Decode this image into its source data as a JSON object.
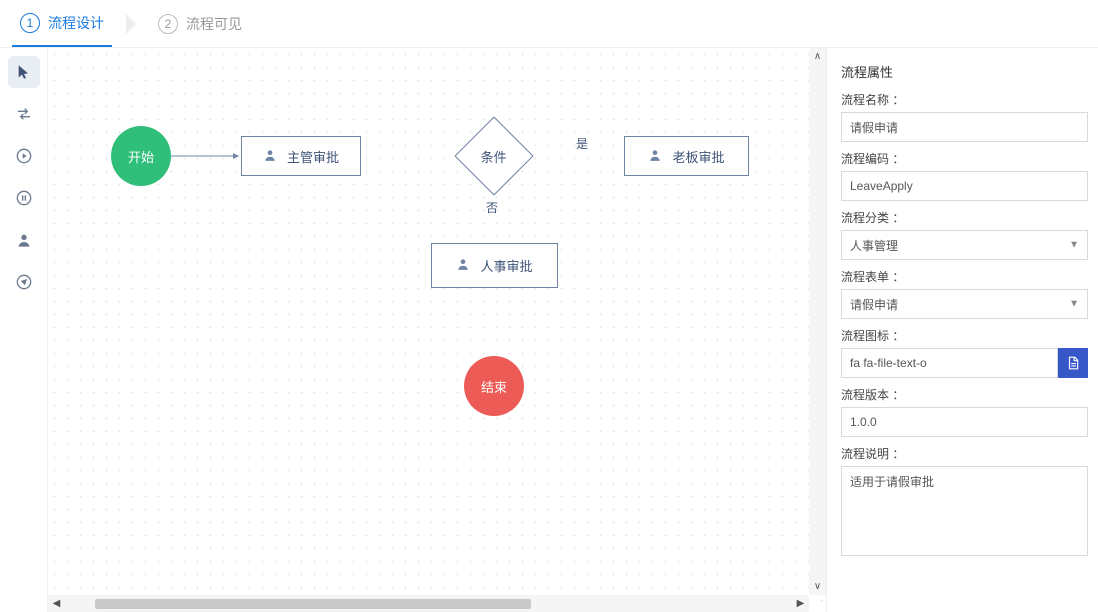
{
  "wizard": {
    "step1_num": "1",
    "step1_label": "流程设计",
    "step2_num": "2",
    "step2_label": "流程可见"
  },
  "nodes": {
    "start": "开始",
    "supervisor": "主管审批",
    "condition_center": "条件",
    "boss": "老板审批",
    "hr": "人事审批",
    "end": "结束"
  },
  "edges": {
    "yes": "是",
    "no": "否"
  },
  "props": {
    "title": "流程属性",
    "name_label": "流程名称",
    "name_value": "请假申请",
    "code_label": "流程编码",
    "code_value": "LeaveApply",
    "category_label": "流程分类",
    "category_value": "人事管理",
    "form_label": "流程表单",
    "form_value": "请假申请",
    "icon_label": "流程图标",
    "icon_value": "fa fa-file-text-o",
    "version_label": "流程版本",
    "version_value": "1.0.0",
    "desc_label": "流程说明",
    "desc_value": "适用于请假审批"
  }
}
